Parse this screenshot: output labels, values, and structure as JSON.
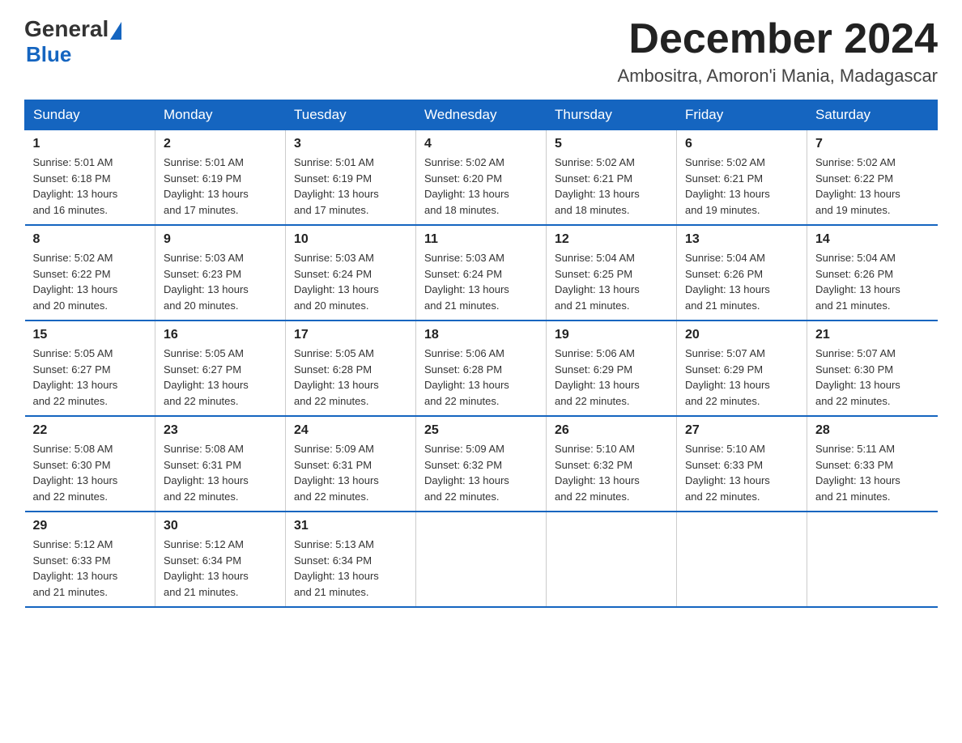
{
  "logo": {
    "general": "General",
    "blue": "Blue"
  },
  "header": {
    "month_title": "December 2024",
    "location": "Ambositra, Amoron'i Mania, Madagascar"
  },
  "weekdays": [
    "Sunday",
    "Monday",
    "Tuesday",
    "Wednesday",
    "Thursday",
    "Friday",
    "Saturday"
  ],
  "weeks": [
    [
      {
        "day": "1",
        "sunrise": "5:01 AM",
        "sunset": "6:18 PM",
        "daylight": "13 hours and 16 minutes."
      },
      {
        "day": "2",
        "sunrise": "5:01 AM",
        "sunset": "6:19 PM",
        "daylight": "13 hours and 17 minutes."
      },
      {
        "day": "3",
        "sunrise": "5:01 AM",
        "sunset": "6:19 PM",
        "daylight": "13 hours and 17 minutes."
      },
      {
        "day": "4",
        "sunrise": "5:02 AM",
        "sunset": "6:20 PM",
        "daylight": "13 hours and 18 minutes."
      },
      {
        "day": "5",
        "sunrise": "5:02 AM",
        "sunset": "6:21 PM",
        "daylight": "13 hours and 18 minutes."
      },
      {
        "day": "6",
        "sunrise": "5:02 AM",
        "sunset": "6:21 PM",
        "daylight": "13 hours and 19 minutes."
      },
      {
        "day": "7",
        "sunrise": "5:02 AM",
        "sunset": "6:22 PM",
        "daylight": "13 hours and 19 minutes."
      }
    ],
    [
      {
        "day": "8",
        "sunrise": "5:02 AM",
        "sunset": "6:22 PM",
        "daylight": "13 hours and 20 minutes."
      },
      {
        "day": "9",
        "sunrise": "5:03 AM",
        "sunset": "6:23 PM",
        "daylight": "13 hours and 20 minutes."
      },
      {
        "day": "10",
        "sunrise": "5:03 AM",
        "sunset": "6:24 PM",
        "daylight": "13 hours and 20 minutes."
      },
      {
        "day": "11",
        "sunrise": "5:03 AM",
        "sunset": "6:24 PM",
        "daylight": "13 hours and 21 minutes."
      },
      {
        "day": "12",
        "sunrise": "5:04 AM",
        "sunset": "6:25 PM",
        "daylight": "13 hours and 21 minutes."
      },
      {
        "day": "13",
        "sunrise": "5:04 AM",
        "sunset": "6:26 PM",
        "daylight": "13 hours and 21 minutes."
      },
      {
        "day": "14",
        "sunrise": "5:04 AM",
        "sunset": "6:26 PM",
        "daylight": "13 hours and 21 minutes."
      }
    ],
    [
      {
        "day": "15",
        "sunrise": "5:05 AM",
        "sunset": "6:27 PM",
        "daylight": "13 hours and 22 minutes."
      },
      {
        "day": "16",
        "sunrise": "5:05 AM",
        "sunset": "6:27 PM",
        "daylight": "13 hours and 22 minutes."
      },
      {
        "day": "17",
        "sunrise": "5:05 AM",
        "sunset": "6:28 PM",
        "daylight": "13 hours and 22 minutes."
      },
      {
        "day": "18",
        "sunrise": "5:06 AM",
        "sunset": "6:28 PM",
        "daylight": "13 hours and 22 minutes."
      },
      {
        "day": "19",
        "sunrise": "5:06 AM",
        "sunset": "6:29 PM",
        "daylight": "13 hours and 22 minutes."
      },
      {
        "day": "20",
        "sunrise": "5:07 AM",
        "sunset": "6:29 PM",
        "daylight": "13 hours and 22 minutes."
      },
      {
        "day": "21",
        "sunrise": "5:07 AM",
        "sunset": "6:30 PM",
        "daylight": "13 hours and 22 minutes."
      }
    ],
    [
      {
        "day": "22",
        "sunrise": "5:08 AM",
        "sunset": "6:30 PM",
        "daylight": "13 hours and 22 minutes."
      },
      {
        "day": "23",
        "sunrise": "5:08 AM",
        "sunset": "6:31 PM",
        "daylight": "13 hours and 22 minutes."
      },
      {
        "day": "24",
        "sunrise": "5:09 AM",
        "sunset": "6:31 PM",
        "daylight": "13 hours and 22 minutes."
      },
      {
        "day": "25",
        "sunrise": "5:09 AM",
        "sunset": "6:32 PM",
        "daylight": "13 hours and 22 minutes."
      },
      {
        "day": "26",
        "sunrise": "5:10 AM",
        "sunset": "6:32 PM",
        "daylight": "13 hours and 22 minutes."
      },
      {
        "day": "27",
        "sunrise": "5:10 AM",
        "sunset": "6:33 PM",
        "daylight": "13 hours and 22 minutes."
      },
      {
        "day": "28",
        "sunrise": "5:11 AM",
        "sunset": "6:33 PM",
        "daylight": "13 hours and 21 minutes."
      }
    ],
    [
      {
        "day": "29",
        "sunrise": "5:12 AM",
        "sunset": "6:33 PM",
        "daylight": "13 hours and 21 minutes."
      },
      {
        "day": "30",
        "sunrise": "5:12 AM",
        "sunset": "6:34 PM",
        "daylight": "13 hours and 21 minutes."
      },
      {
        "day": "31",
        "sunrise": "5:13 AM",
        "sunset": "6:34 PM",
        "daylight": "13 hours and 21 minutes."
      },
      null,
      null,
      null,
      null
    ]
  ],
  "labels": {
    "sunrise": "Sunrise:",
    "sunset": "Sunset:",
    "daylight": "Daylight:"
  }
}
